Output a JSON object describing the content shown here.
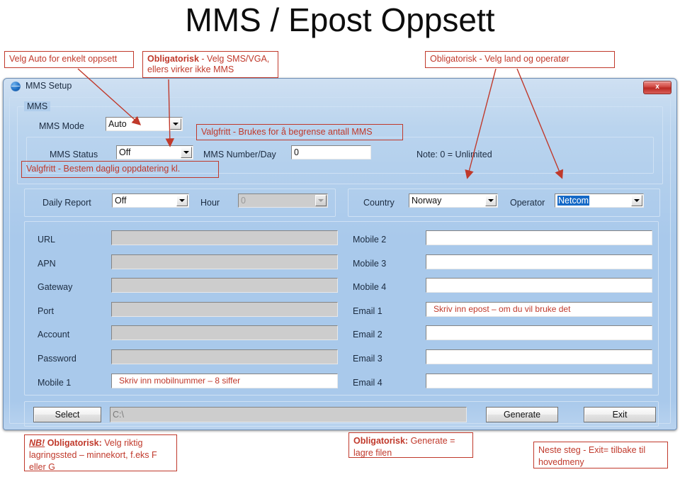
{
  "slide": {
    "title": "MMS / Epost Oppsett"
  },
  "callouts": {
    "auto_mode": "Velg Auto for enkelt oppsett",
    "mandatory_sms_b": "Obligatorisk",
    "mandatory_sms_rest": " - Velg SMS/VGA, ellers virker ikke MMS",
    "country_operator": "Obligatorisk - Velg land og operatør",
    "limit_mms": "Valgfritt - Brukes for å begrense antall MMS",
    "daily_update": "Valgfritt  - Bestem daglig oppdatering kl.",
    "mobile_hint": "Skriv inn mobilnummer – 8 siffer",
    "email_hint": "Skriv inn epost – om du vil bruke det",
    "storage_nb": "NB!",
    "storage_b": " Obligatorisk:",
    "storage_rest": " Velg riktig lagringssted – minnekort, f.eks  F eller G",
    "generate_b": "Obligatorisk:",
    "generate_rest": " Generate = lagre filen",
    "exit_note": "Neste steg - Exit= tilbake til hovedmeny"
  },
  "window": {
    "title": "MMS Setup",
    "icon": "globe-icon",
    "close_label": "x"
  },
  "mms_group": {
    "legend": "MMS",
    "mode_label": "MMS Mode",
    "mode_value": "Auto",
    "status_label": "MMS Status",
    "status_value": "Off",
    "number_per_day_label": "MMS Number/Day",
    "number_per_day_value": "0",
    "note": "Note: 0 = Unlimited"
  },
  "daily_group": {
    "report_label": "Daily Report",
    "report_value": "Off",
    "hour_label": "Hour",
    "hour_value": "0"
  },
  "country_group": {
    "country_label": "Country",
    "country_value": "Norway",
    "operator_label": "Operator",
    "operator_value": "Netcom"
  },
  "settings_left": [
    {
      "label": "URL",
      "value": "",
      "disabled": true
    },
    {
      "label": "APN",
      "value": "",
      "disabled": true
    },
    {
      "label": "Gateway",
      "value": "",
      "disabled": true
    },
    {
      "label": "Port",
      "value": "",
      "disabled": true
    },
    {
      "label": "Account",
      "value": "",
      "disabled": true
    },
    {
      "label": "Password",
      "value": "",
      "disabled": true
    },
    {
      "label": "Mobile 1",
      "value": "Skriv inn mobilnummer – 8 siffer",
      "disabled": false,
      "annotated": true
    }
  ],
  "settings_right": [
    {
      "label": "Mobile 2",
      "value": "",
      "disabled": false
    },
    {
      "label": "Mobile 3",
      "value": "",
      "disabled": false
    },
    {
      "label": "Mobile 4",
      "value": "",
      "disabled": false
    },
    {
      "label": "Email 1",
      "value": "Skriv inn epost – om du vil bruke det",
      "disabled": false,
      "annotated": true
    },
    {
      "label": "Email 2",
      "value": "",
      "disabled": false
    },
    {
      "label": "Email 3",
      "value": "",
      "disabled": false
    },
    {
      "label": "Email 4",
      "value": "",
      "disabled": false
    }
  ],
  "footer": {
    "select_label": "Select",
    "path_value": "C:\\",
    "generate_label": "Generate",
    "exit_label": "Exit"
  },
  "colors": {
    "annotation_red": "#c0392b",
    "window_blue": "#a9c9eb",
    "selection_blue": "#1569c7",
    "close_red": "#bb2a24"
  }
}
